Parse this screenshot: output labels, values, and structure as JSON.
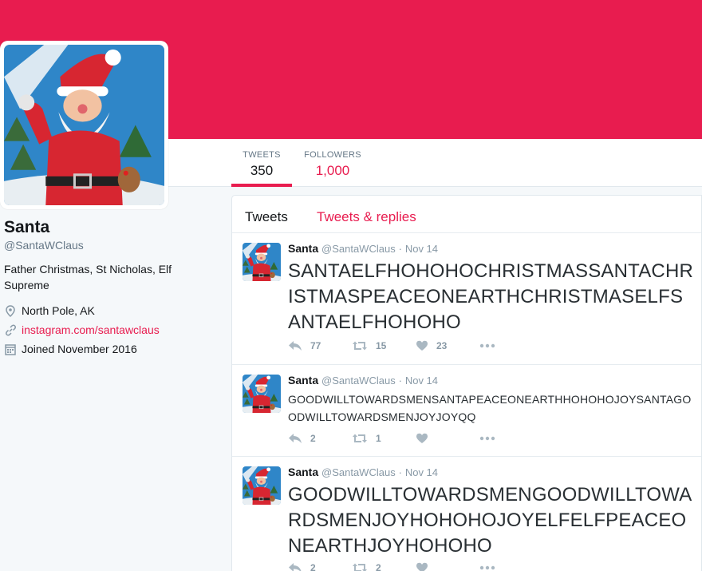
{
  "profile": {
    "name": "Santa",
    "handle": "@SantaWClaus",
    "bio": "Father Christmas, St Nicholas, Elf Supreme",
    "location": "North Pole, AK",
    "website": "instagram.com/santawclaus",
    "joined": "Joined November 2016"
  },
  "stats": {
    "tweets_label": "TWEETS",
    "tweets_value": "350",
    "followers_label": "FOLLOWERS",
    "followers_value": "1,000"
  },
  "tabs": {
    "tweets": "Tweets",
    "replies": "Tweets & replies"
  },
  "tweets": [
    {
      "name": "Santa",
      "handle": "@SantaWClaus",
      "dot": "·",
      "date": "Nov 14",
      "text": "SANTAELFHOHOHOCHRISTMASSANTACHRISTMASPEACEONEARTHCHRISTMASELFSANTAELFHOHOHO",
      "replies": "77",
      "retweets": "15",
      "likes": "23"
    },
    {
      "name": "Santa",
      "handle": "@SantaWClaus",
      "dot": "·",
      "date": "Nov 14",
      "text": "GOODWILLTOWARDSMENSANTAPEACEONEARTHHOHOHOJOYSANTAGOODWILLTOWARDSMENJOYJOYQQ",
      "replies": "2",
      "retweets": "1",
      "likes": ""
    },
    {
      "name": "Santa",
      "handle": "@SantaWClaus",
      "dot": "·",
      "date": "Nov 14",
      "text": "GOODWILLTOWARDSMENGOODWILLTOWARDSMENJOYHOHOHOJOYELFELFPEACEONEARTHJOYHOHOHO",
      "replies": "2",
      "retweets": "2",
      "likes": ""
    }
  ],
  "icons": {
    "location": "map-pin-icon",
    "link": "link-icon",
    "calendar": "calendar-icon",
    "reply": "reply-icon",
    "retweet": "retweet-icon",
    "like": "heart-icon",
    "more": "more-icon"
  },
  "colors": {
    "accent": "#e81c4f",
    "muted": "#657786",
    "icon": "#aab8c2"
  }
}
